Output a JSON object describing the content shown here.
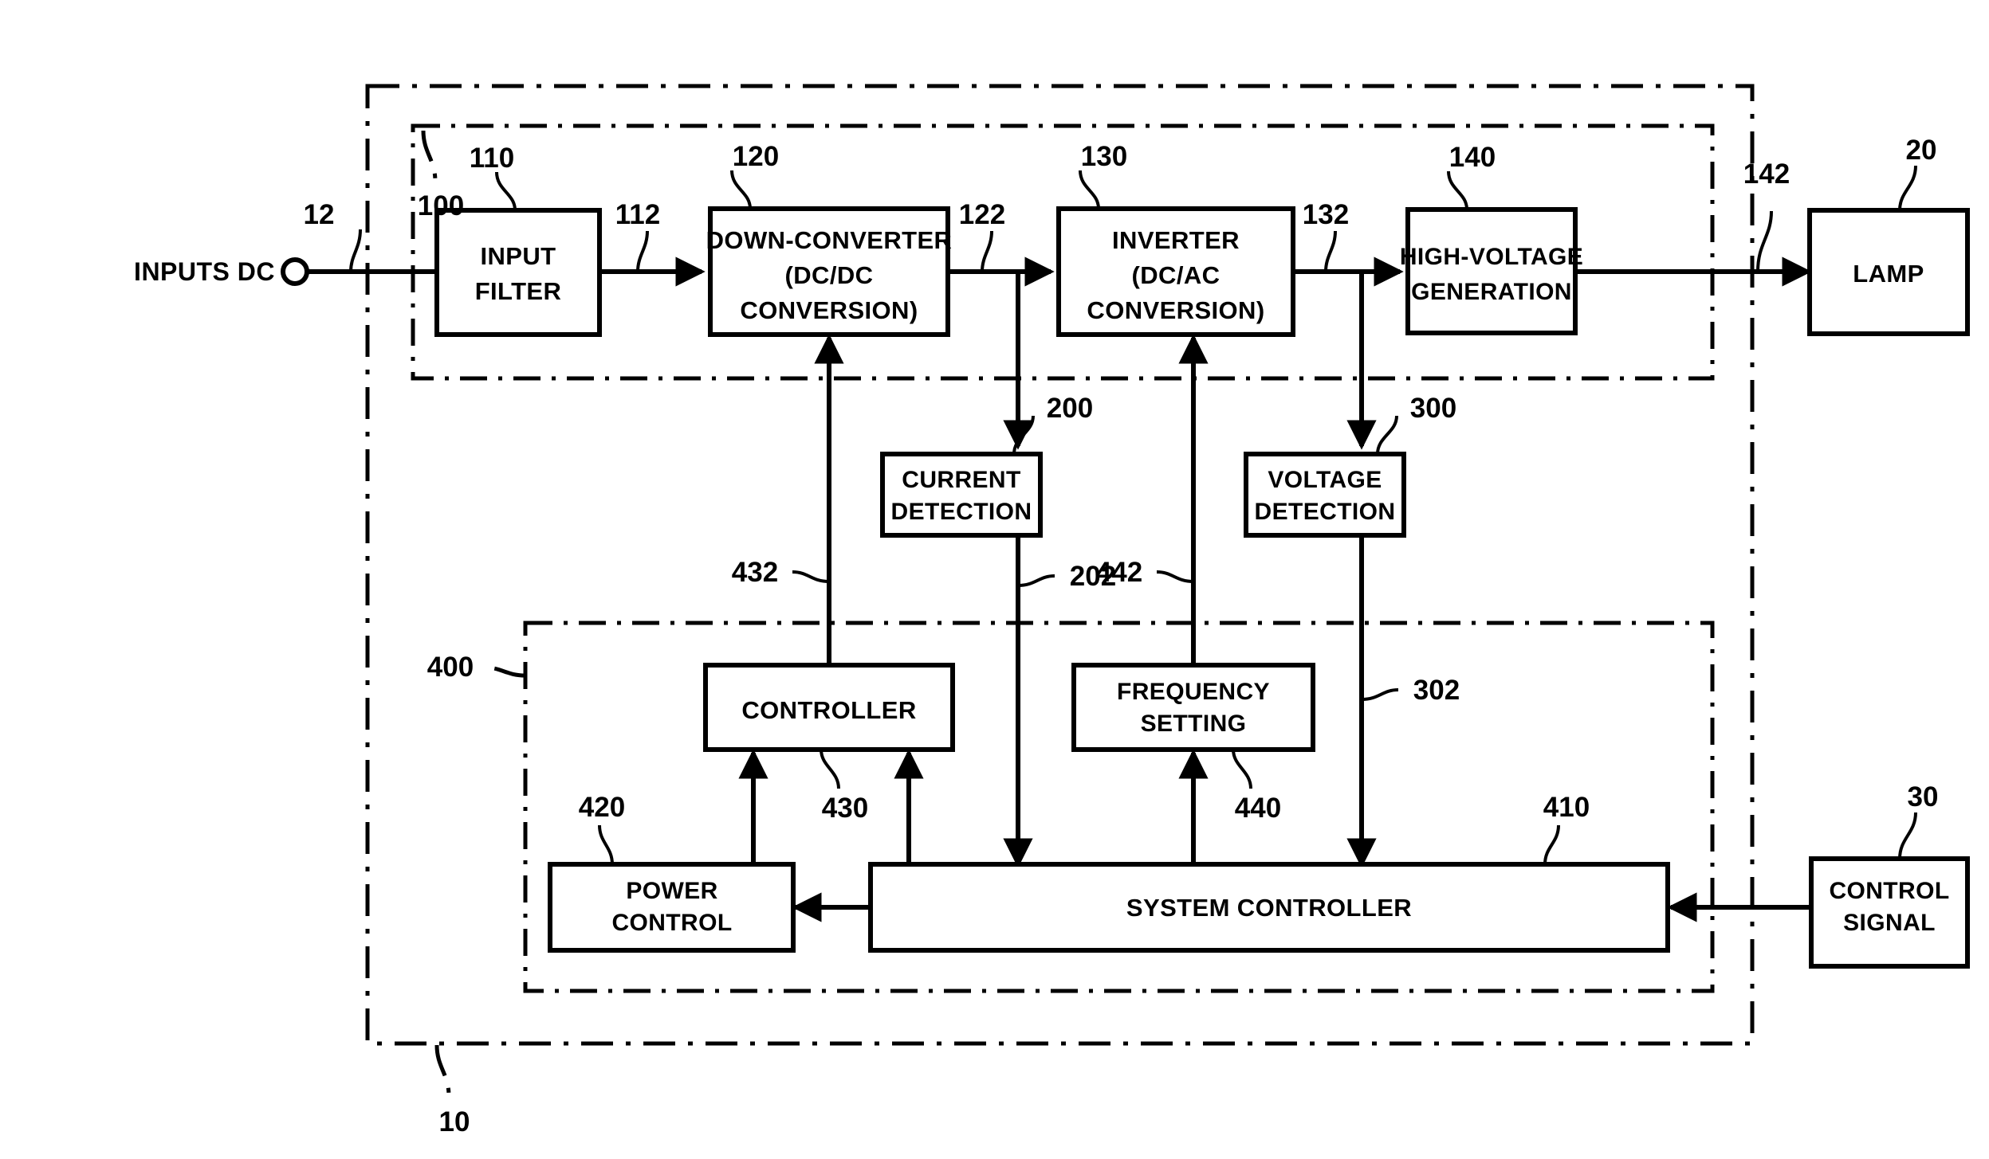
{
  "figure": {
    "type": "patent-block-diagram",
    "description": "Lamp lighting device block diagram",
    "input_terminal_label": "INPUTS DC"
  },
  "blocks": [
    {
      "id": "input-filter",
      "lines": [
        "INPUT",
        "FILTER"
      ],
      "ref": "110"
    },
    {
      "id": "down-converter",
      "lines": [
        "DOWN-CONVERTER",
        "(DC/DC",
        "CONVERSION)"
      ],
      "ref": "120"
    },
    {
      "id": "inverter",
      "lines": [
        "INVERTER",
        "(DC/AC",
        "CONVERSION)"
      ],
      "ref": "130"
    },
    {
      "id": "high-voltage",
      "lines": [
        "HIGH-VOLTAGE",
        "GENERATION"
      ],
      "ref": "140"
    },
    {
      "id": "lamp",
      "lines": [
        "LAMP"
      ],
      "ref": "20"
    },
    {
      "id": "current-detection",
      "lines": [
        "CURRENT",
        "DETECTION"
      ],
      "ref": "200"
    },
    {
      "id": "voltage-detection",
      "lines": [
        "VOLTAGE",
        "DETECTION"
      ],
      "ref": "300"
    },
    {
      "id": "controller",
      "lines": [
        "CONTROLLER"
      ],
      "ref": "430"
    },
    {
      "id": "frequency-setting",
      "lines": [
        "FREQUENCY",
        "SETTING"
      ],
      "ref": "440"
    },
    {
      "id": "power-control",
      "lines": [
        "POWER",
        "CONTROL"
      ],
      "ref": "420"
    },
    {
      "id": "system-controller",
      "lines": [
        "SYSTEM CONTROLLER"
      ],
      "ref": "410"
    },
    {
      "id": "control-signal",
      "lines": [
        "CONTROL",
        "SIGNAL"
      ],
      "ref": "30"
    }
  ],
  "reference_numerals": {
    "device_outer": "10",
    "power_stage": "100",
    "control_stage": "400",
    "input_line": "12",
    "filter_out": "112",
    "converter_out": "122",
    "inverter_out": "132",
    "hv_out": "142",
    "current_sense": "202",
    "voltage_sense": "302",
    "freq_signal": "442",
    "ctrl_signal": "432",
    "input_filter": "110",
    "down_converter": "120",
    "inverter": "130",
    "high_voltage": "140",
    "lamp": "20",
    "current_detection": "200",
    "voltage_detection": "300",
    "controller": "430",
    "frequency_setting": "440",
    "power_control": "420",
    "system_controller": "410",
    "control_signal_src": "30"
  },
  "colors": {
    "ink": "#000000",
    "paper": "#ffffff"
  }
}
